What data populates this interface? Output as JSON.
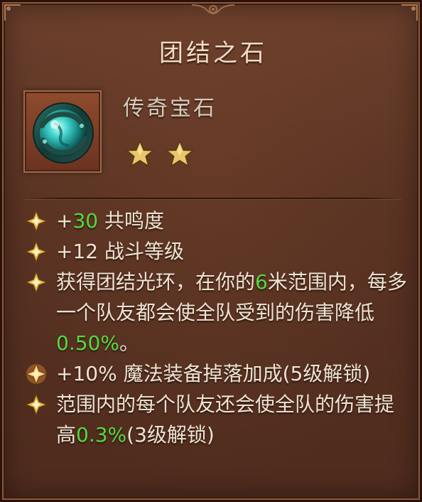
{
  "title": "团结之石",
  "item": {
    "icon": "jade-dragon-gem-icon",
    "rarity": "传奇宝石",
    "stars": 2
  },
  "colors": {
    "highlight": "#54d93c",
    "text": "#efe3d2",
    "title": "#f1dcc3",
    "panel": "#5a3323"
  },
  "attributes": [
    {
      "bullet": "gold-diamond-bullet-icon",
      "parts": [
        {
          "text": "+",
          "highlight": false
        },
        {
          "text": "30",
          "highlight": true
        },
        {
          "text": " 共鸣度",
          "highlight": false
        }
      ]
    },
    {
      "bullet": "gold-diamond-bullet-icon",
      "parts": [
        {
          "text": "+12 战斗等级",
          "highlight": false
        }
      ]
    },
    {
      "bullet": "gold-diamond-bullet-icon",
      "parts": [
        {
          "text": "获得团结光环，在你的",
          "highlight": false
        },
        {
          "text": "6",
          "highlight": true
        },
        {
          "text": "米范围内，每多一个队友都会使全队受到的伤害降低",
          "highlight": false
        },
        {
          "text": "0.50%",
          "highlight": true
        },
        {
          "text": "。",
          "highlight": false
        }
      ]
    },
    {
      "bullet": "glowing-bullet-icon",
      "parts": [
        {
          "text": "+10% 魔法装备掉落加成(5级解锁)",
          "highlight": false
        }
      ]
    },
    {
      "bullet": "gold-diamond-bullet-icon",
      "parts": [
        {
          "text": "范围内的每个队友还会使全队的伤害提高",
          "highlight": false
        },
        {
          "text": "0.3%",
          "highlight": true
        },
        {
          "text": "(3级解锁)",
          "highlight": false
        }
      ]
    }
  ]
}
